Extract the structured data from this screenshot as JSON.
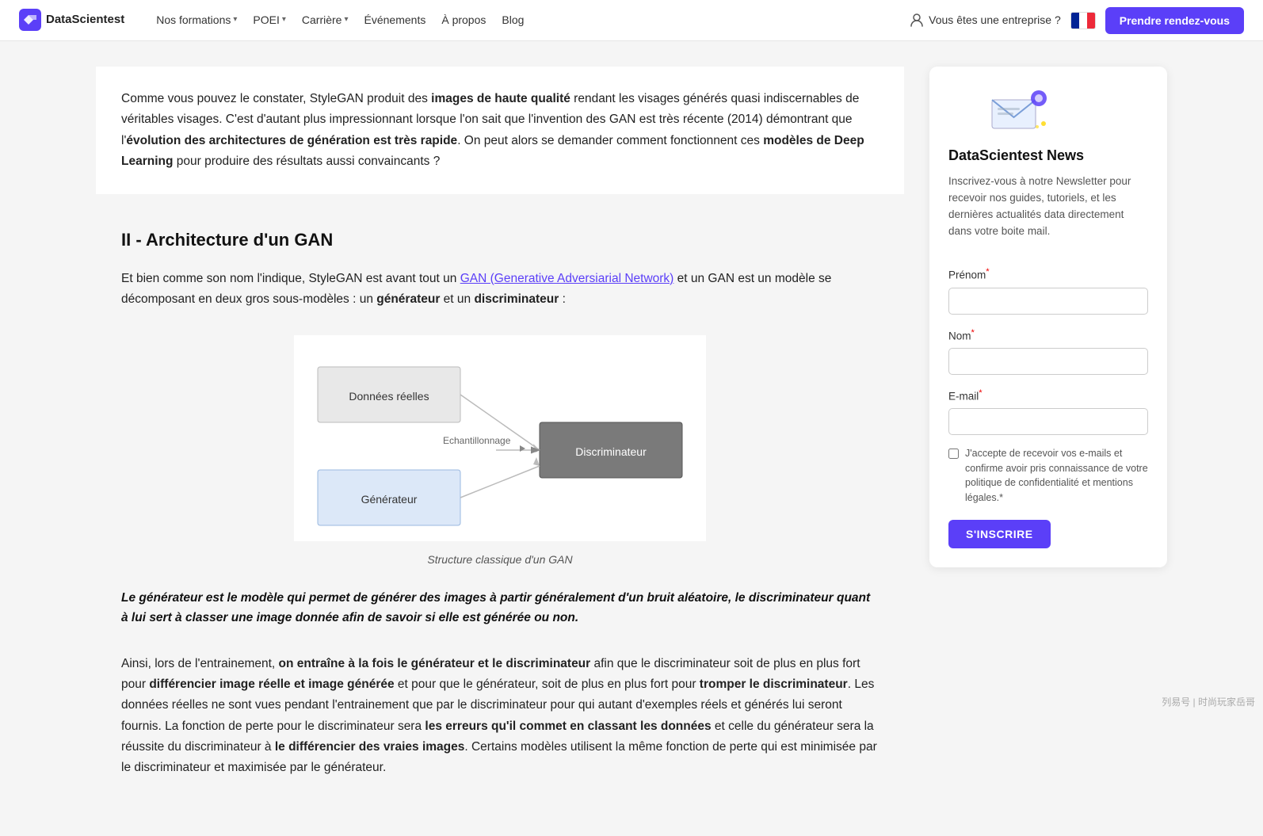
{
  "navbar": {
    "logo_text": "DataScientest",
    "nav_items": [
      {
        "label": "Nos formations",
        "has_chevron": true
      },
      {
        "label": "POEI",
        "has_chevron": true
      },
      {
        "label": "Carrière",
        "has_chevron": true
      },
      {
        "label": "Événements",
        "has_chevron": false
      },
      {
        "label": "À propos",
        "has_chevron": false
      },
      {
        "label": "Blog",
        "has_chevron": false
      }
    ],
    "enterprise_label": "Vous êtes une entreprise ?",
    "cta_label": "Prendre rendez-vous"
  },
  "article": {
    "intro_text_1": "Comme vous pouvez le constater, StyleGAN produit des ",
    "intro_bold_1": "images de haute qualité",
    "intro_text_2": " rendant les visages générés quasi indiscernables de véritables visages. C'est d'autant plus impressionnant lorsque l'on sait que l'invention des GAN est très récente (2014) démontrant que l'",
    "intro_bold_2": "évolution des architectures de génération est très rapide",
    "intro_text_3": ". On peut alors se demander comment fonctionnent ces ",
    "intro_bold_3": "modèles de Deep Learning",
    "intro_text_4": " pour produire des résultats aussi convaincants ?",
    "section_heading": "II - Architecture d'un GAN",
    "section_body_1": "Et bien comme son nom l'indique, StyleGAN est avant tout un ",
    "section_link": "GAN (Generative Adversiarial Network)",
    "section_body_2": " et un GAN est un modèle se décomposant en deux gros sous-modèles : un ",
    "section_bold_1": "générateur",
    "section_body_3": " et un ",
    "section_bold_2": "discriminateur",
    "section_body_4": " :",
    "diagram_caption": "Structure classique d'un GAN",
    "callout_quote": "Le générateur est le modèle qui permet de générer des images à partir généralement d'un bruit aléatoire, le discriminateur quant à lui sert à classer une image donnée afin de savoir si elle est générée ou non.",
    "body2_1": "Ainsi, lors de l'entrainement, ",
    "body2_bold1": "on entraîne à la fois le générateur et le discriminateur",
    "body2_2": " afin que le discriminateur soit de plus en plus fort pour ",
    "body2_bold2": "différencier image réelle et image générée",
    "body2_3": " et pour que le générateur, soit de plus en plus fort pour ",
    "body2_bold3": "tromper le discriminateur",
    "body2_4": ". Les données réelles ne sont vues pendant l'entrainement que par le discriminateur pour qui autant d'exemples réels et générés lui seront fournis. La fonction de perte pour le discriminateur sera ",
    "body2_bold4": "les erreurs qu'il commet en classant les données",
    "body2_5": " et celle du générateur sera la réussite du discriminateur à ",
    "body2_bold5": "le différencier des vraies images",
    "body2_6": ". Certains modèles utilisent la même fonction de perte qui est minimisée par le discriminateur et maximisée par le générateur.",
    "diagram": {
      "data_reelles_label": "Données réelles",
      "echantillonnage_label": "Echantillonnage",
      "discriminateur_label": "Discriminateur",
      "generateur_label": "Générateur"
    }
  },
  "sidebar": {
    "newsletter_title": "DataScientest News",
    "newsletter_desc": "Inscrivez-vous à notre Newsletter pour recevoir nos guides, tutoriels, et les dernières actualités data directement dans votre boite mail.",
    "prenom_label": "Prénom",
    "nom_label": "Nom",
    "email_label": "E-mail",
    "required_marker": "*",
    "checkbox_text": "J'accepte de recevoir vos e-mails et confirme avoir pris connaissance de votre politique de confidentialité et mentions légales.*",
    "subscribe_btn_label": "S'INSCRIRE"
  },
  "watermark": "列易号 | 时尚玩家岳哥"
}
